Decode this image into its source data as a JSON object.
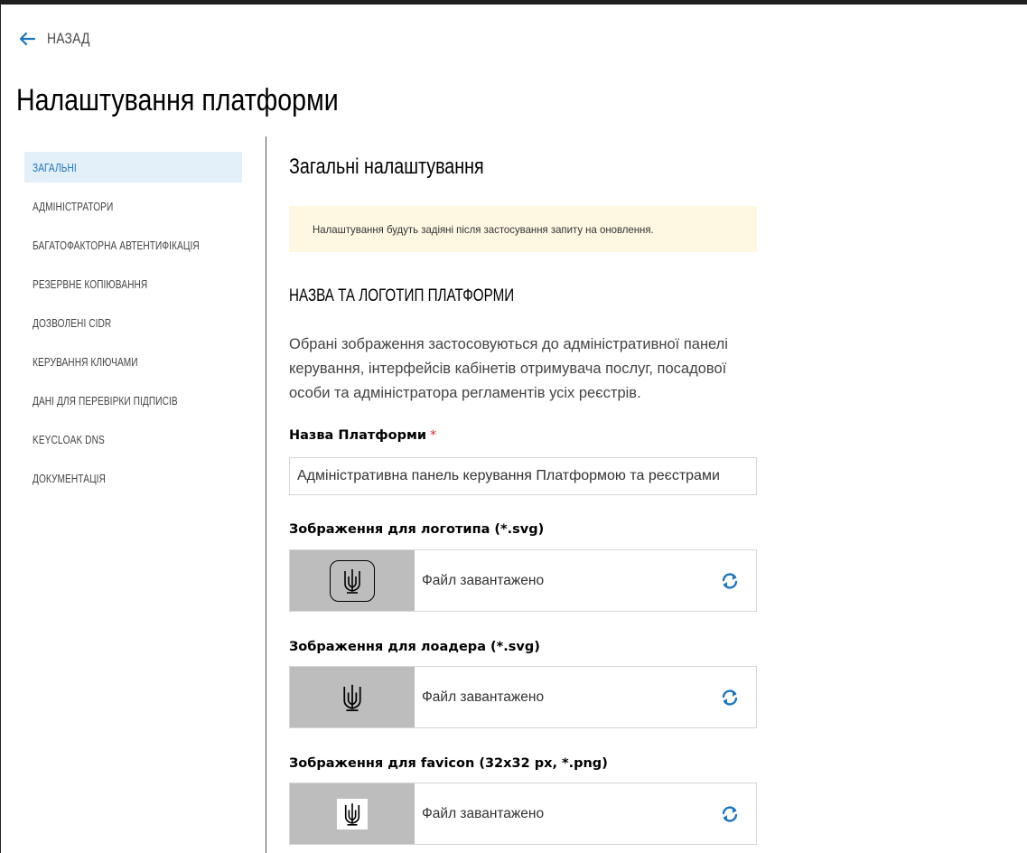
{
  "nav": {
    "back_label": "НАЗАД"
  },
  "page": {
    "title": "Налаштування платформи"
  },
  "sidebar": {
    "items": [
      {
        "label": "ЗАГАЛЬНІ",
        "active": true
      },
      {
        "label": "АДМІНІСТРАТОРИ"
      },
      {
        "label": "БАГАТОФАКТОРНА АВТЕНТИФІКАЦІЯ"
      },
      {
        "label": "РЕЗЕРВНЕ КОПІЮВАННЯ"
      },
      {
        "label": "ДОЗВОЛЕНІ CIDR"
      },
      {
        "label": "КЕРУВАННЯ КЛЮЧАМИ"
      },
      {
        "label": "ДАНІ ДЛЯ ПЕРЕВІРКИ ПІДПИСІВ"
      },
      {
        "label": "KEYCLOAK DNS"
      },
      {
        "label": "ДОКУМЕНТАЦІЯ"
      }
    ]
  },
  "main": {
    "section_title": "Загальні налаштування",
    "notice": "Налаштування будуть задіяні після застосування запиту на оновлення.",
    "subheading": "НАЗВА ТА ЛОГОТИП ПЛАТФОРМИ",
    "description": "Обрані зображення застосовуються до адміністративної панелі керування, інтерфейсів кабінетів отримувача послуг, посадової особи та адміністратора регламентів усіх реєстрів.",
    "platform_name": {
      "label": "Назва Платформи",
      "required_mark": "*",
      "value": "Адміністративна панель керування Платформою та реєстрами"
    },
    "logo_upload": {
      "label": "Зображення для логотипа (*.svg)",
      "status": "Файл завантажено",
      "icon": "trident-icon"
    },
    "loader_upload": {
      "label": "Зображення для лоадера (*.svg)",
      "status": "Файл завантажено",
      "icon": "trident-icon"
    },
    "favicon_upload": {
      "label": "Зображення для favicon (32x32 px, *.png)",
      "status": "Файл завантажено",
      "icon": "trident-icon"
    }
  },
  "colors": {
    "accent": "#1c75bc",
    "active_bg": "#e3f0fa",
    "notice_bg": "#fef8e3",
    "required": "#d32f2f",
    "thumb_bg": "#bdbdbd"
  }
}
